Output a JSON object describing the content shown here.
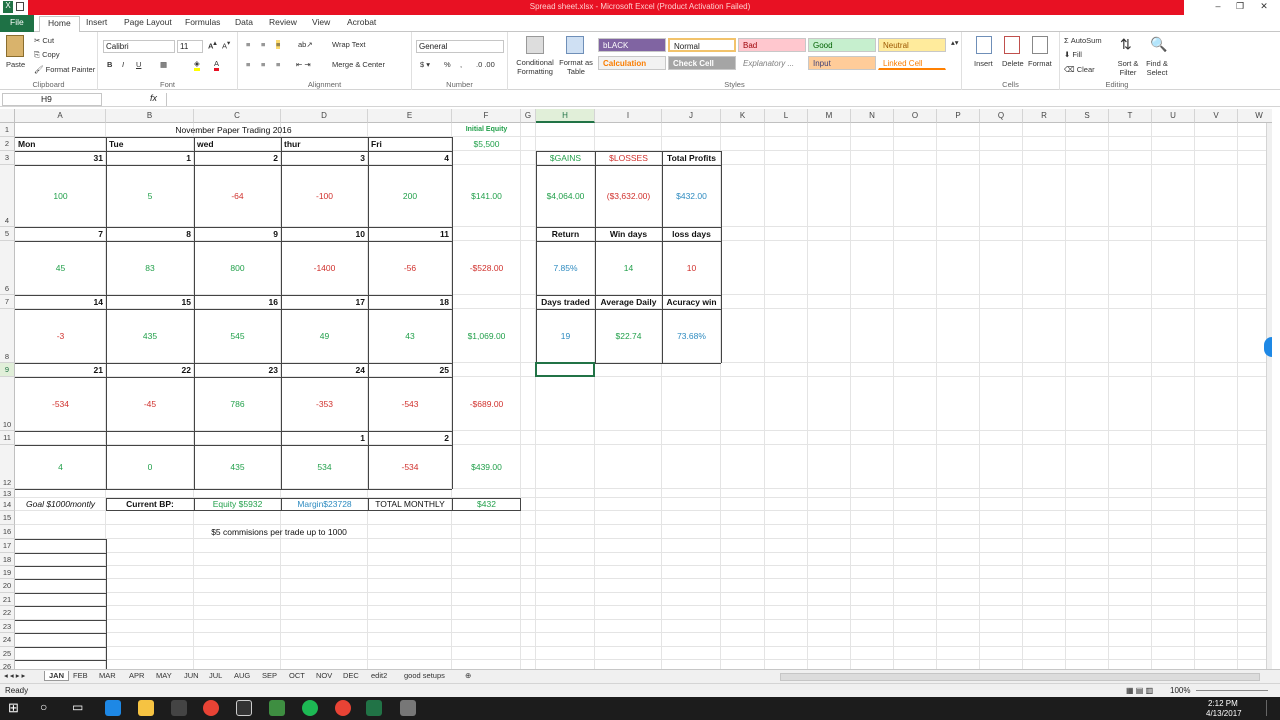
{
  "window": {
    "title": "Spread sheet.xlsx - Microsoft Excel (Product Activation Failed)"
  },
  "ribbon": {
    "tabs": [
      "File",
      "Home",
      "Insert",
      "Page Layout",
      "Formulas",
      "Data",
      "Review",
      "View",
      "Acrobat"
    ],
    "clipboard": {
      "paste": "Paste",
      "cut": "Cut",
      "copy": "Copy",
      "format_painter": "Format Painter",
      "label": "Clipboard"
    },
    "font": {
      "name": "Calibri",
      "size": "11",
      "label": "Font"
    },
    "alignment": {
      "wrap": "Wrap Text",
      "merge": "Merge & Center",
      "label": "Alignment"
    },
    "number": {
      "format": "General",
      "label": "Number"
    },
    "styles": {
      "conditional": "Conditional Formatting",
      "format_table": "Format as Table",
      "label": "Styles",
      "cells": [
        "bLACK",
        "Normal",
        "Bad",
        "Good",
        "Neutral",
        "Calculation",
        "Check Cell",
        "Explanatory ...",
        "Input",
        "Linked Cell"
      ]
    },
    "cells": {
      "insert": "Insert",
      "delete": "Delete",
      "format": "Format",
      "label": "Cells"
    },
    "editing": {
      "autosum": "AutoSum",
      "fill": "Fill",
      "clear": "Clear",
      "sort": "Sort & Filter",
      "find": "Find & Select",
      "label": "Editing"
    }
  },
  "formula_bar": {
    "name_box": "H9",
    "fx": "fx",
    "formula": ""
  },
  "columns": [
    "A",
    "B",
    "C",
    "D",
    "E",
    "F",
    "G",
    "H",
    "I",
    "J",
    "K",
    "L",
    "M",
    "N",
    "O",
    "P",
    "Q",
    "R",
    "S",
    "T",
    "U",
    "V",
    "W"
  ],
  "rows": [
    "1",
    "2",
    "3",
    "4",
    "5",
    "6",
    "7",
    "8",
    "9",
    "10",
    "11",
    "12",
    "13",
    "14",
    "15",
    "16",
    "17",
    "18",
    "19",
    "20",
    "21",
    "22",
    "23",
    "24",
    "25",
    "26"
  ],
  "sheet": {
    "title": "November Paper Trading 2016",
    "initial_equity_label": "Initial Equity",
    "initial_equity": "$5,500",
    "days": [
      "Mon",
      "Tue",
      "wed",
      "thur",
      "Fri"
    ],
    "weeks": [
      {
        "dates": [
          "31",
          "1",
          "2",
          "3",
          "4"
        ],
        "values": [
          "100",
          "5",
          "-64",
          "-100",
          "200"
        ],
        "total": "$141.00"
      },
      {
        "dates": [
          "7",
          "8",
          "9",
          "10",
          "11"
        ],
        "values": [
          "45",
          "83",
          "800",
          "-1400",
          "-56"
        ],
        "total": "-$528.00"
      },
      {
        "dates": [
          "14",
          "15",
          "16",
          "17",
          "18"
        ],
        "values": [
          "-3",
          "435",
          "545",
          "49",
          "43"
        ],
        "total": "$1,069.00"
      },
      {
        "dates": [
          "21",
          "22",
          "23",
          "24",
          "25"
        ],
        "values": [
          "-534",
          "-45",
          "786",
          "-353",
          "-543"
        ],
        "total": "-$689.00"
      },
      {
        "dates": [
          "",
          "",
          "",
          "1",
          "2"
        ],
        "values": [
          "4",
          "0",
          "435",
          "534",
          "-534"
        ],
        "total": "$439.00"
      }
    ],
    "stats": {
      "gains_label": "$GAINS",
      "losses_label": "$LOSSES",
      "total_profits_label": "Total Profits",
      "gains": "$4,064.00",
      "losses": "($3,632.00)",
      "total_profits": "$432.00",
      "return_label": "Return",
      "win_days_label": "Win days",
      "loss_days_label": "loss days",
      "return": "7.85%",
      "win_days": "14",
      "loss_days": "10",
      "days_traded_label": "Days traded",
      "avg_daily_label": "Average Daily",
      "accuracy_label": "Acuracy win",
      "days_traded": "19",
      "avg_daily": "$22.74",
      "accuracy": "73.68%"
    },
    "goal": "Goal $1000montly",
    "current_bp": "Current BP:",
    "equity": "Equity  $5932",
    "margin": "Margin$23728",
    "total_monthly_label": "TOTAL MONTHLY",
    "total_monthly": "$432",
    "commissions": "$5 commisions per trade up to 1000"
  },
  "sheet_tabs": [
    "JAN",
    "FEB",
    "MAR",
    "APR",
    "MAY",
    "JUN",
    "JUL",
    "AUG",
    "SEP",
    "OCT",
    "NOV",
    "DEC",
    "edit2",
    "good setups"
  ],
  "status": {
    "ready": "Ready",
    "zoom": "100%"
  },
  "taskbar": {
    "time": "2:12 PM",
    "date": "4/13/2017"
  },
  "colors": {
    "excel_green": "#217346",
    "title_red": "#e81123",
    "gain_green": "#22a04b",
    "loss_red": "#d0312d",
    "blue": "#2e8bc0"
  }
}
